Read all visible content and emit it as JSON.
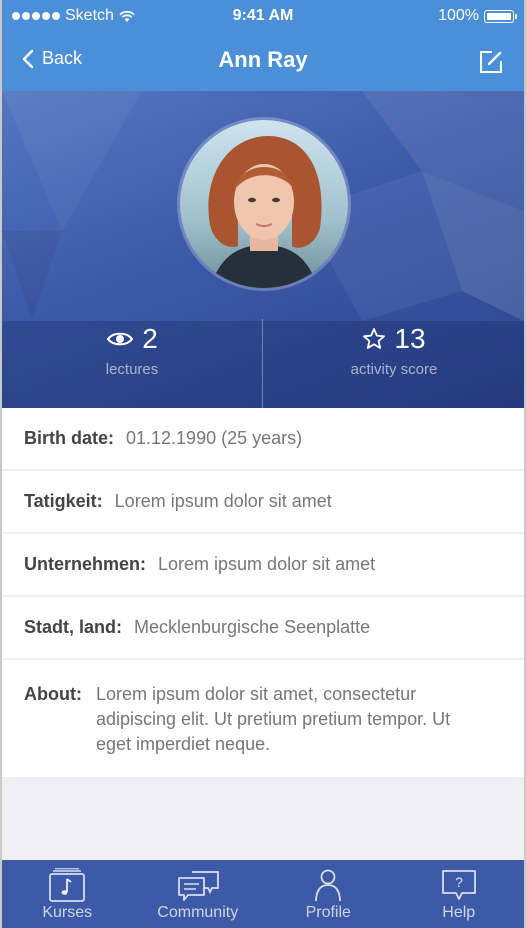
{
  "status_bar": {
    "carrier": "Sketch",
    "time": "9:41 AM",
    "battery": "100%"
  },
  "nav": {
    "back_label": "Back",
    "title": "Ann Ray",
    "edit_icon": "edit-icon"
  },
  "stats": [
    {
      "icon": "eye-icon",
      "value": "2",
      "label": "lectures"
    },
    {
      "icon": "star-icon",
      "value": "13",
      "label": "activity score"
    }
  ],
  "info": {
    "birth": {
      "key": "Birth date:",
      "value": "01.12.1990 (25 years)"
    },
    "tatigkeit": {
      "key": "Tatigkeit:",
      "value": "Lorem ipsum dolor sit amet"
    },
    "unternehmen": {
      "key": "Unternehmen:",
      "value": "Lorem ipsum dolor sit amet"
    },
    "stadt": {
      "key": "Stadt, land:",
      "value": "Mecklenburgische Seenplatte"
    },
    "about": {
      "key": "About:",
      "value": "Lorem ipsum dolor sit amet, consectetur adipiscing elit. Ut pretium pretium tempor. Ut eget imperdiet neque."
    }
  },
  "tabs": [
    {
      "label": "Kurses",
      "icon": "music-book-icon"
    },
    {
      "label": "Community",
      "icon": "chat-bubbles-icon"
    },
    {
      "label": "Profile",
      "icon": "person-icon"
    },
    {
      "label": "Help",
      "icon": "help-bubble-icon"
    }
  ],
  "colors": {
    "primary": "#4a8fd8",
    "tabbar": "#3c5aa8"
  }
}
